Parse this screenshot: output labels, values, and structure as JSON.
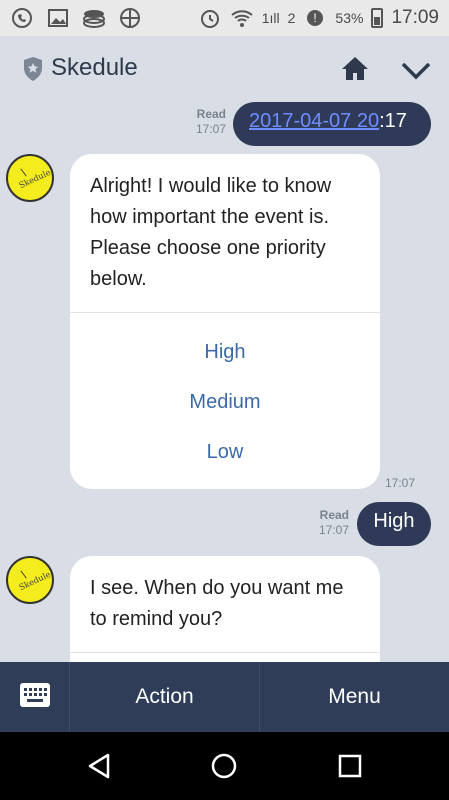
{
  "statusbar": {
    "icons_left": [
      "whatsapp-icon",
      "gallery-icon",
      "layers-icon",
      "web-icon"
    ],
    "signal_label": "1ıll",
    "network_label": "2",
    "battery_percent": "53%",
    "time": "17:09"
  },
  "header": {
    "title": "Skedule",
    "icons": [
      "shield-icon",
      "home-icon",
      "chevron-down-icon"
    ]
  },
  "messages": {
    "outgoing_1": {
      "read_label": "Read",
      "time": "17:07",
      "link_text": "2017-04-07 20",
      "text_suffix": ":17"
    },
    "incoming_1": {
      "text": "Alright! I would like to know how important the event is. Please choose one priority below.",
      "options": [
        "High",
        "Medium",
        "Low"
      ],
      "time": "17:07"
    },
    "outgoing_2": {
      "read_label": "Read",
      "time": "17:07",
      "text": "High"
    },
    "incoming_2": {
      "text": "I see. When do you want me to remind you?"
    }
  },
  "actionbar": {
    "keyboard_icon": "keyboard-icon",
    "action_label": "Action",
    "menu_label": "Menu"
  },
  "colors": {
    "header_bg": "#d9dde5",
    "outgoing_bubble": "#2e3a57",
    "option_text": "#3c6aa8",
    "actionbar_bg": "#2f3d58",
    "avatar_yellow": "#f4ec1d"
  }
}
